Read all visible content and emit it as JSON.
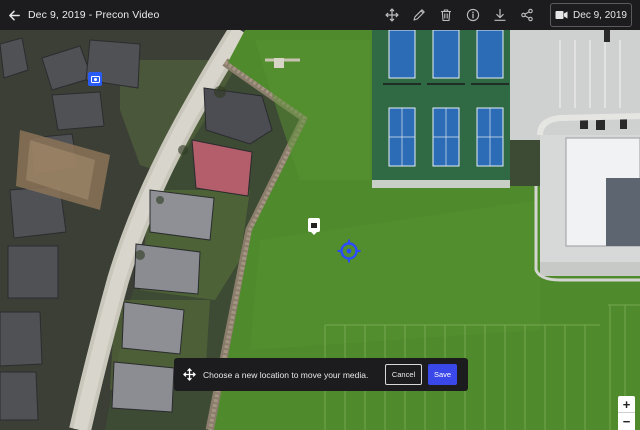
{
  "header": {
    "title": "Dec 9, 2019 - Precon Video",
    "tools": [
      "move-icon",
      "pencil-icon",
      "trash-icon",
      "info-icon",
      "download-icon",
      "share-icon"
    ],
    "date_chip": "Dec 9, 2019"
  },
  "move_dialog": {
    "message": "Choose a new location to move your media.",
    "cancel_label": "Cancel",
    "save_label": "Save"
  },
  "zoom": {
    "in_label": "+",
    "out_label": "−"
  },
  "colors": {
    "topbar": "#1c1c1e",
    "accent": "#3a48ea",
    "target": "#2a4bff",
    "grass": "#4f8a2c",
    "court": "#2d6db5"
  }
}
